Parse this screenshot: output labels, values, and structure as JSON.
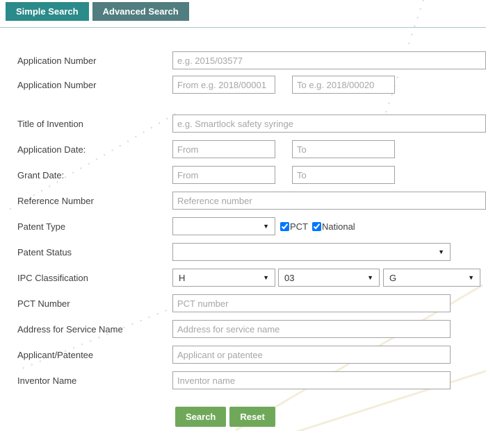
{
  "tabs": [
    {
      "label": "Simple Search",
      "active": true
    },
    {
      "label": "Advanced Search",
      "active": false
    }
  ],
  "fields": {
    "application_number": {
      "label": "Application Number",
      "placeholder": "e.g. 2015/03577",
      "value": ""
    },
    "application_number_range": {
      "label": "Application Number",
      "from_placeholder": "From e.g. 2018/00001",
      "to_placeholder": "To e.g. 2018/00020",
      "from_value": "",
      "to_value": ""
    },
    "title_of_invention": {
      "label": "Title of Invention",
      "placeholder": "e.g. Smartlock safety syringe",
      "value": ""
    },
    "application_date": {
      "label": "Application Date:",
      "from_placeholder": "From",
      "to_placeholder": "To",
      "from_value": "",
      "to_value": ""
    },
    "grant_date": {
      "label": "Grant Date:",
      "from_placeholder": "From",
      "to_placeholder": "To",
      "from_value": "",
      "to_value": ""
    },
    "reference_number": {
      "label": "Reference Number",
      "placeholder": "Reference number",
      "value": ""
    },
    "patent_type": {
      "label": "Patent Type",
      "selected_value": "",
      "checkboxes": [
        {
          "label": "PCT",
          "checked": true
        },
        {
          "label": "National",
          "checked": true
        }
      ]
    },
    "patent_status": {
      "label": "Patent Status",
      "selected_value": ""
    },
    "ipc_classification": {
      "label": "IPC Classification",
      "section": "H",
      "ipc_class": "03",
      "subclass": "G"
    },
    "pct_number": {
      "label": "PCT Number",
      "placeholder": "PCT number",
      "value": ""
    },
    "address_for_service_name": {
      "label": "Address for Service Name",
      "placeholder": "Address for service name",
      "value": ""
    },
    "applicant_patentee": {
      "label": "Applicant/Patentee",
      "placeholder": "Applicant or patentee",
      "value": ""
    },
    "inventor_name": {
      "label": "Inventor Name",
      "placeholder": "Inventor name",
      "value": ""
    }
  },
  "actions": {
    "search": "Search",
    "reset": "Reset"
  },
  "icons": {
    "dropdown_arrow": "▼"
  },
  "colors": {
    "active_tab": "#2b8a8a",
    "inactive_tab": "#507d80",
    "divider": "#a9c6cb",
    "button_green": "#70a85a"
  }
}
